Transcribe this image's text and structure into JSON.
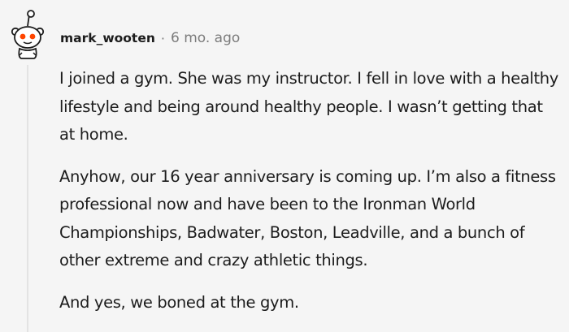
{
  "comment": {
    "username": "mark_wooten",
    "separator": "·",
    "timestamp": "6 mo. ago",
    "paragraphs": [
      "I joined a gym. She was my instructor. I fell in love with a healthy lifestyle and being around healthy people. I wasn’t getting that at home.",
      "Anyhow, our 16 year anniversary is coming up. I’m also a fitness professional now and have been to the Ironman World Championships, Badwater, Boston, Leadville, and a bunch of other extreme and crazy athletic things.",
      "And yes, we boned at the gym."
    ]
  },
  "colors": {
    "background": "#f5f5f5",
    "text": "#1c1c1c",
    "meta": "#7c7c7c",
    "avatar_eyes": "#ff4500",
    "thread_line": "#e3e3e3"
  },
  "icons": {
    "avatar": "reddit-snoo-avatar-icon"
  }
}
